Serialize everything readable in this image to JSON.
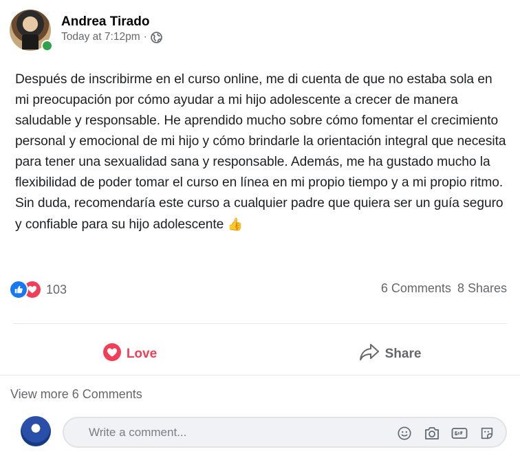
{
  "post": {
    "author": "Andrea Tirado",
    "timestamp": "Today at 7:12pm",
    "separator": "·",
    "privacy_icon": "globe-icon",
    "text": "Después de inscribirme en el curso online, me di cuenta de que no estaba sola en mi preocupación por cómo ayudar a mi hijo adolescente a crecer de manera saludable y responsable. He aprendido mucho sobre cómo fomentar el crecimiento personal y emocional de mi hijo y cómo brindarle la orientación integral que necesita para tener una sexualidad sana y responsable. Además, me ha gustado mucho la flexibilidad de poder tomar el curso en línea en mi propio tiempo y a mi propio ritmo. Sin duda, recomendaría este curso a cualquier padre que quiera ser un guía seguro y confiable para su hijo adolescente",
    "emoji": "👍"
  },
  "reactions": {
    "icons": [
      "like-icon",
      "love-icon"
    ],
    "count": "103"
  },
  "stats": {
    "comments": "6 Comments",
    "shares": "8 Shares"
  },
  "actions": {
    "love_label": "Love",
    "share_label": "Share"
  },
  "comments": {
    "view_more": "View more 6 Comments",
    "placeholder": "Write a comment..."
  },
  "colors": {
    "love": "#f33e58",
    "like": "#1877f2",
    "online": "#31a24c",
    "muted": "#65676b"
  }
}
